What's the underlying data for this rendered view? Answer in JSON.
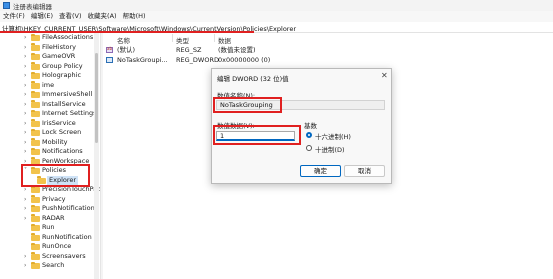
{
  "window": {
    "title": "注册表编辑器"
  },
  "menu": [
    "文件(F)",
    "编辑(E)",
    "查看(V)",
    "收藏夹(A)",
    "帮助(H)"
  ],
  "address": "计算机\\HKEY_CURRENT_USER\\Software\\Microsoft\\Windows\\CurrentVersion\\Policies\\Explorer",
  "tree": {
    "items": [
      {
        "label": "FileAssociations",
        "expander": "›"
      },
      {
        "label": "FileHistory",
        "expander": "›"
      },
      {
        "label": "GameOVR",
        "expander": "›"
      },
      {
        "label": "Group Policy",
        "expander": "›"
      },
      {
        "label": "Holographic",
        "expander": "›"
      },
      {
        "label": "ime",
        "expander": "›"
      },
      {
        "label": "ImmersiveShell",
        "expander": "›"
      },
      {
        "label": "InstallService",
        "expander": "›"
      },
      {
        "label": "Internet Settings",
        "expander": "›"
      },
      {
        "label": "IrisService",
        "expander": "›"
      },
      {
        "label": "Lock Screen",
        "expander": "›"
      },
      {
        "label": "Mobility",
        "expander": "›"
      },
      {
        "label": "Notifications",
        "expander": "›"
      },
      {
        "label": "PenWorkspace",
        "expander": "›"
      },
      {
        "label": "Policies",
        "expander": "˅"
      },
      {
        "label": "Explorer",
        "expander": ""
      },
      {
        "label": "PrecisionTouchPad",
        "expander": "›"
      },
      {
        "label": "Privacy",
        "expander": "›"
      },
      {
        "label": "PushNotifications",
        "expander": "›"
      },
      {
        "label": "RADAR",
        "expander": "›"
      },
      {
        "label": "Run",
        "expander": ""
      },
      {
        "label": "RunNotification",
        "expander": ""
      },
      {
        "label": "RunOnce",
        "expander": ""
      },
      {
        "label": "Screensavers",
        "expander": "›"
      },
      {
        "label": "Search",
        "expander": "›"
      }
    ]
  },
  "list": {
    "headers": {
      "name": "名称",
      "type": "类型",
      "data": "数据"
    },
    "rows": [
      {
        "name": "(默认)",
        "type": "REG_SZ",
        "data": "(数值未设置)",
        "icon": "string-value-icon"
      },
      {
        "name": "NoTaskGroupi...",
        "type": "REG_DWORD",
        "data": "0x00000000 (0)",
        "icon": "dword-value-icon"
      }
    ]
  },
  "dialog": {
    "title": "编辑 DWORD (32 位)值",
    "close": "✕",
    "name_label": "数值名称(N):",
    "name_value": "NoTaskGrouping",
    "data_label": "数值数据(V):",
    "data_value": "1",
    "base_label": "基数",
    "hex_label": "十六进制(H)",
    "dec_label": "十进制(D)",
    "selected_base": "hex",
    "ok": "确定",
    "cancel": "取消"
  },
  "colors": {
    "highlight_box": "#e02020",
    "accent": "#0067c0",
    "folder": "#f2c34c"
  }
}
